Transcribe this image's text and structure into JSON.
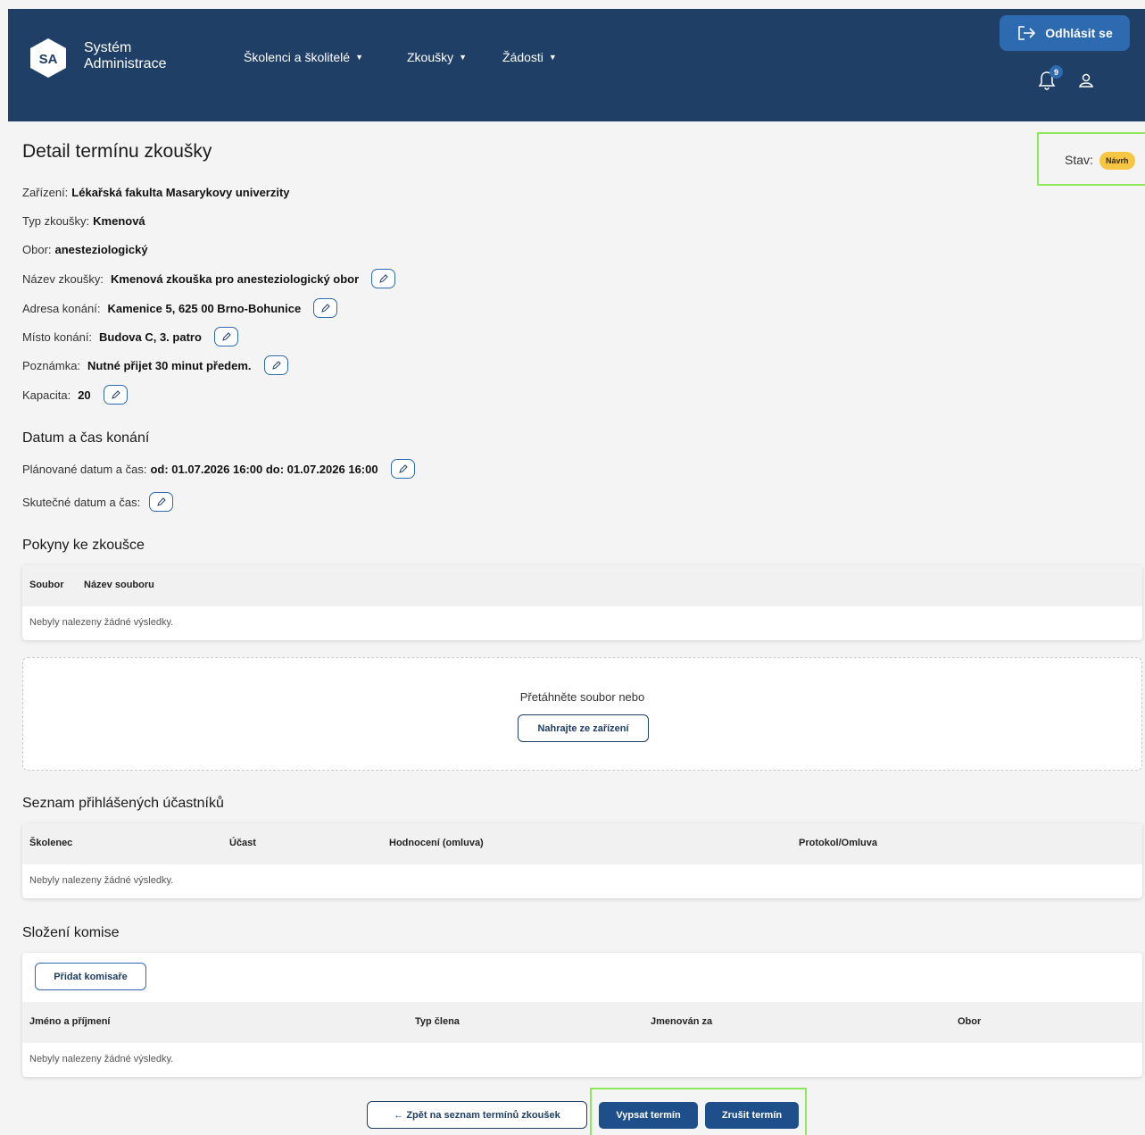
{
  "header": {
    "logo_initials": "SA",
    "logo_line1": "Systém",
    "logo_line2": "Administrace",
    "nav": [
      "Školenci a školitelé",
      "Zkoušky",
      "Žádosti"
    ],
    "logout_label": "Odhlásit se",
    "notification_count": "9"
  },
  "page": {
    "title": "Detail termínu zkoušky",
    "status_label": "Stav:",
    "status_value": "Návrh"
  },
  "details": {
    "zarizeni_label": "Zařízení:",
    "zarizeni_value": "Lékařská fakulta Masarykovy univerzity",
    "typ_label": "Typ zkoušky:",
    "typ_value": "Kmenová",
    "obor_label": "Obor:",
    "obor_value": "anesteziologický",
    "nazev_label": "Název zkoušky:",
    "nazev_value": "Kmenová zkouška pro anesteziologický obor",
    "adresa_label": "Adresa konání:",
    "adresa_value": "Kamenice 5, 625 00 Brno-Bohunice",
    "misto_label": "Místo konání:",
    "misto_value": "Budova C, 3. patro",
    "poznamka_label": "Poznámka:",
    "poznamka_value": "Nutné přijet 30 minut předem.",
    "kapacita_label": "Kapacita:",
    "kapacita_value": "20"
  },
  "datetime": {
    "title": "Datum a čas konání",
    "planned_label": "Plánované datum a čas:",
    "planned_value": "od: 01.07.2026 16:00 do: 01.07.2026 16:00",
    "actual_label": "Skutečné datum a čas:"
  },
  "instructions": {
    "title": "Pokyny ke zkoušce",
    "columns": [
      "Soubor",
      "Název souboru"
    ],
    "empty": "Nebyly nalezeny žádné výsledky.",
    "drop_text": "Přetáhněte soubor nebo",
    "upload_label": "Nahrajte ze zařízení"
  },
  "participants": {
    "title": "Seznam přihlášených účastníků",
    "columns": [
      "Školenec",
      "Účast",
      "Hodnocení (omluva)",
      "Protokol/Omluva"
    ],
    "empty": "Nebyly nalezeny žádné výsledky."
  },
  "committee": {
    "title": "Složení komise",
    "add_label": "Přidat komisaře",
    "columns": [
      "Jméno a příjmení",
      "Typ člena",
      "Jmenován za",
      "Obor"
    ],
    "empty": "Nebyly nalezeny žádné výsledky."
  },
  "footer": {
    "back_label": "← Zpět na seznam termínů zkoušek",
    "publish_label": "Vypsat termín",
    "cancel_label": "Zrušit termín"
  },
  "colors": {
    "header_bg": "#1f3f66",
    "accent": "#2d6ab0",
    "status_badge": "#f5c543",
    "highlight": "#8de85c"
  }
}
